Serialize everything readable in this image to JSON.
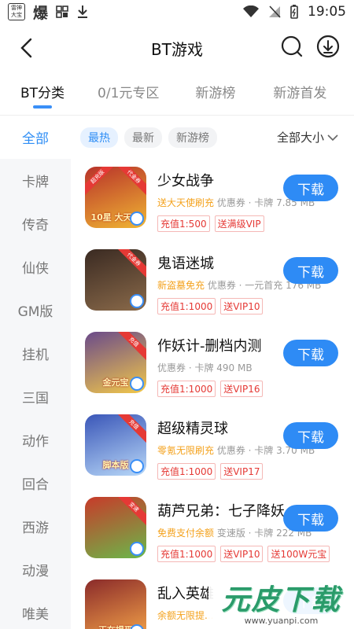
{
  "status": {
    "app_box": "雷神大宝",
    "bao": "爆",
    "time": "19:05"
  },
  "header": {
    "title": "BT游戏"
  },
  "tabs": [
    {
      "label": "BT分类"
    },
    {
      "label": "0/1元专区"
    },
    {
      "label": "新游榜"
    },
    {
      "label": "新游首发"
    }
  ],
  "sidebar": [
    {
      "label": "全部"
    },
    {
      "label": "卡牌"
    },
    {
      "label": "传奇"
    },
    {
      "label": "仙侠"
    },
    {
      "label": "GM版"
    },
    {
      "label": "挂机"
    },
    {
      "label": "三国"
    },
    {
      "label": "动作"
    },
    {
      "label": "回合"
    },
    {
      "label": "西游"
    },
    {
      "label": "动漫"
    },
    {
      "label": "唯美"
    }
  ],
  "filters": {
    "chips": [
      "最热",
      "最新",
      "新游榜"
    ],
    "size_label": "全部大小"
  },
  "download_label": "下载",
  "games": [
    {
      "name": "少女战争",
      "highlight": "送大天使刷充",
      "meta": " 优惠券 · 卡牌  7.85 MB",
      "tags": [
        "充值1:500",
        "送满级VIP"
      ],
      "icon_text": "10星 大天使",
      "ribbon_l": "超充版",
      "ribbon_r": "代金券",
      "c1": "#b8322a",
      "c2": "#f0b533"
    },
    {
      "name": "鬼语迷城",
      "highlight": "新盗墓免充",
      "meta": " 优惠券 · 一元首充  176 MB",
      "tags": [
        "充值1:1000",
        "送VIP10"
      ],
      "icon_text": "",
      "ribbon_l": "",
      "ribbon_r": "代金券",
      "c1": "#3a2a22",
      "c2": "#8a6a4a"
    },
    {
      "name": "作妖计-删档内测",
      "highlight": "",
      "meta": "优惠券 · 卡牌  490 MB",
      "tags": [
        "充值1:1000",
        "送VIP16"
      ],
      "icon_text": "金元宝",
      "ribbon_l": "",
      "ribbon_r": "充值",
      "c1": "#6a4a8a",
      "c2": "#f2c84a"
    },
    {
      "name": "超级精灵球",
      "highlight": "零氪无限刷充",
      "meta": " 优惠券 · 卡牌  3.70 MB",
      "tags": [
        "充值1:1000",
        "送VIP17"
      ],
      "icon_text": "脚本版",
      "ribbon_l": "",
      "ribbon_r": "充值",
      "c1": "#3a56b8",
      "c2": "#b8d8f8"
    },
    {
      "name": "葫芦兄弟：七子降妖",
      "highlight": "免费支付余额",
      "meta": " 变速版 · 卡牌  222 MB",
      "tags": [
        "充值1:1000",
        "送VIP10",
        "送100W元宝"
      ],
      "icon_text": "",
      "ribbon_l": "",
      "ribbon_r": "变速",
      "c1": "#c83a2a",
      "c2": "#6ab84a"
    },
    {
      "name": "乱入英雄",
      "highlight": "余额无限提...",
      "meta": "",
      "tags": [],
      "icon_text": "正在提现",
      "ribbon_l": "",
      "ribbon_r": "",
      "c1": "#8a2a2a",
      "c2": "#f8a84a"
    }
  ],
  "watermark": {
    "main": "元皮下载",
    "sub": "www.yuanpi.com"
  }
}
